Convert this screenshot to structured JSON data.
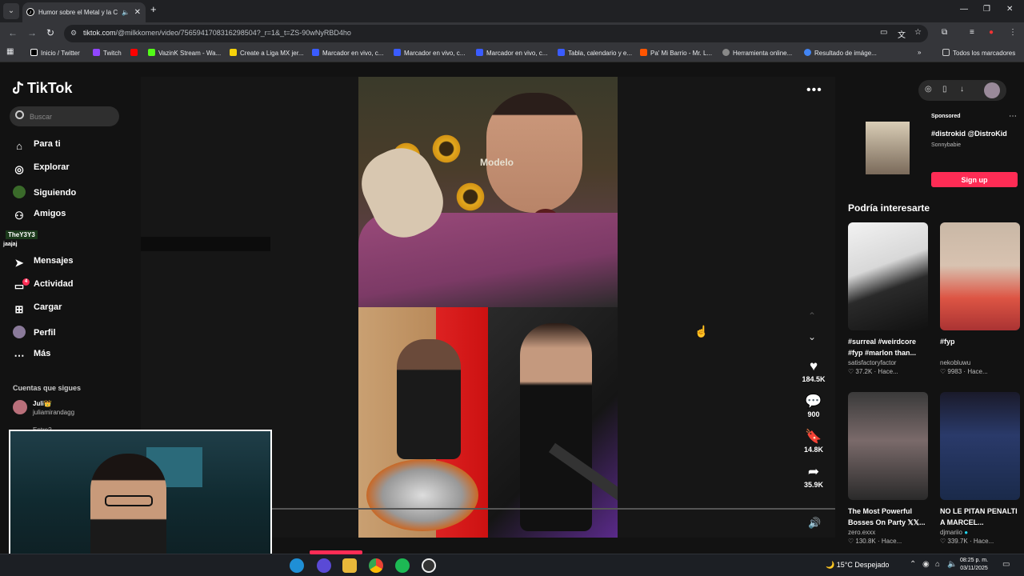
{
  "browser": {
    "tab_title": "Humor sobre el Metal y la C",
    "url_host": "tiktok.com",
    "url_path": "/@milkkomen/video/7565941708316298504?_r=1&_t=ZS-90wNyRBD4ho",
    "bookmarks": [
      "Inicio / Twitter",
      "Twitch",
      "",
      "VazinK Stream - Wa...",
      "Create a Liga MX jer...",
      "Marcador en vivo, c...",
      "Marcador en vivo, c...",
      "Marcador en vivo, c...",
      "Tabla, calendario y e...",
      "Pa' Mi Barrio - Mr. L...",
      "Herramienta online...",
      "Resultado de imáge..."
    ],
    "all_bookmarks": "Todos los marcadores"
  },
  "sidebar": {
    "logo": "TikTok",
    "search_placeholder": "Buscar",
    "items": [
      {
        "label": "Para ti",
        "icon": "home-icon"
      },
      {
        "label": "Explorar",
        "icon": "compass-icon"
      },
      {
        "label": "Siguiendo",
        "icon": "following-icon"
      },
      {
        "label": "Amigos",
        "icon": "friends-icon"
      },
      {
        "label": "Mensajes",
        "icon": "messages-icon"
      },
      {
        "label": "Actividad",
        "icon": "activity-icon",
        "badge": "4"
      },
      {
        "label": "Cargar",
        "icon": "upload-icon"
      },
      {
        "label": "Perfil",
        "icon": "profile-icon"
      },
      {
        "label": "Más",
        "icon": "more-icon"
      }
    ],
    "overlay_tag": "TheY3Y3",
    "overlay_tag2": "jaajaj",
    "following_title": "Cuentas que sigues",
    "following": [
      {
        "name": "Juli👑",
        "handle": "juliamirandagg"
      }
    ],
    "following_next": "Entre?"
  },
  "video": {
    "overlay_text": "Modelo",
    "actions": [
      {
        "icon": "heart-icon",
        "count": "184.5K"
      },
      {
        "icon": "comment-icon",
        "count": "900"
      },
      {
        "icon": "bookmark-icon",
        "count": "14.8K"
      },
      {
        "icon": "share-icon",
        "count": "35.9K"
      }
    ],
    "progress": 0.0
  },
  "right": {
    "sponsored_label": "Sponsored",
    "sponsored_title": "#distrokid @DistroKid",
    "sponsored_sub": "Sonnybabie",
    "signup_label": "Sign up",
    "recommend_title": "Podría interesarte",
    "cards": [
      {
        "caption": "#surreal #weirdcore #fyp #marlon than...",
        "user": "satisfactoryfactor",
        "likes": "37.2K",
        "time": "Hace..."
      },
      {
        "caption": "#fyp",
        "user": "nekobluwu",
        "likes": "9983",
        "time": "Hace..."
      },
      {
        "caption": "The Most Powerful Bosses On Party 𝕏𝕏...",
        "user": "zero.exxx",
        "likes": "130.8K",
        "time": "Hace..."
      },
      {
        "caption": "NO LE PITAN PENALTI A MARCEL...",
        "user": "djmariio",
        "likes": "339.7K",
        "time": "Hace..."
      }
    ]
  },
  "taskbar": {
    "weather": "15°C  Despejado",
    "time": "08:25 p. m.",
    "date": "03/11/2025"
  },
  "colors": {
    "accent": "#fe2c55",
    "background": "#121212"
  }
}
